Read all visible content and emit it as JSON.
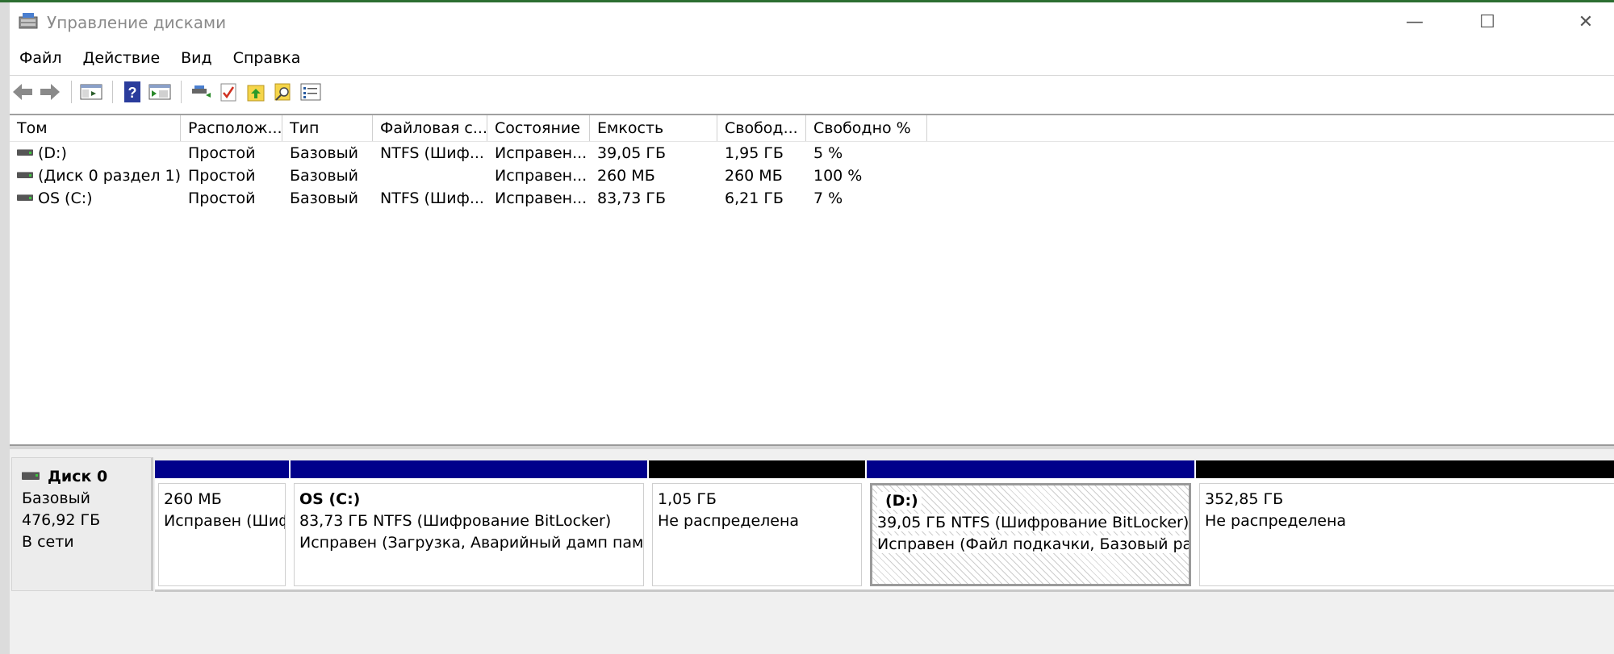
{
  "window": {
    "title": "Управление дисками",
    "controls": {
      "minimize": "—",
      "maximize": "☐",
      "close": "✕"
    }
  },
  "menu": [
    "Файл",
    "Действие",
    "Вид",
    "Справка"
  ],
  "toolbar": {
    "icons": [
      "back-icon",
      "forward-icon",
      "show-hide-console-tree-icon",
      "help-icon",
      "properties-icon",
      "connect-icon",
      "check-icon",
      "folder-up-icon",
      "find-icon",
      "list-icon"
    ]
  },
  "volume_list": {
    "columns": [
      "Том",
      "Располож...",
      "Тип",
      "Файловая с...",
      "Состояние",
      "Емкость",
      "Свобод...",
      "Свободно %"
    ],
    "rows": [
      [
        "(D:)",
        "Простой",
        "Базовый",
        "NTFS (Шиф...",
        "Исправен...",
        "39,05 ГБ",
        "1,95 ГБ",
        "5 %"
      ],
      [
        "(Диск 0 раздел 1)",
        "Простой",
        "Базовый",
        "",
        "Исправен...",
        "260 МБ",
        "260 МБ",
        "100 %"
      ],
      [
        "OS (C:)",
        "Простой",
        "Базовый",
        "NTFS (Шиф...",
        "Исправен...",
        "83,73 ГБ",
        "6,21 ГБ",
        "7 %"
      ]
    ]
  },
  "disk": {
    "name": "Диск 0",
    "type": "Базовый",
    "size": "476,92 ГБ",
    "status": "В сети"
  },
  "partitions": [
    {
      "label": "",
      "line1": "260 МБ",
      "line2": "Исправен (Шифрова",
      "bar": "blue"
    },
    {
      "label": "OS  (C:)",
      "line1": "83,73 ГБ NTFS (Шифрование BitLocker)",
      "line2": "Исправен (Загрузка, Аварийный дамп памяти",
      "bar": "blue"
    },
    {
      "label": "",
      "line1": "1,05 ГБ",
      "line2": "Не распределена",
      "bar": "black"
    },
    {
      "label": "(D:)",
      "line1": "39,05 ГБ NTFS (Шифрование BitLocker)",
      "line2": "Исправен (Файл подкачки, Базовый разде",
      "bar": "blue"
    },
    {
      "label": "",
      "line1": "352,85 ГБ",
      "line2": "Не распределена",
      "bar": "black"
    }
  ],
  "colors": {
    "primary_partition_bar": "#00008b",
    "unallocated_bar": "#000000"
  }
}
